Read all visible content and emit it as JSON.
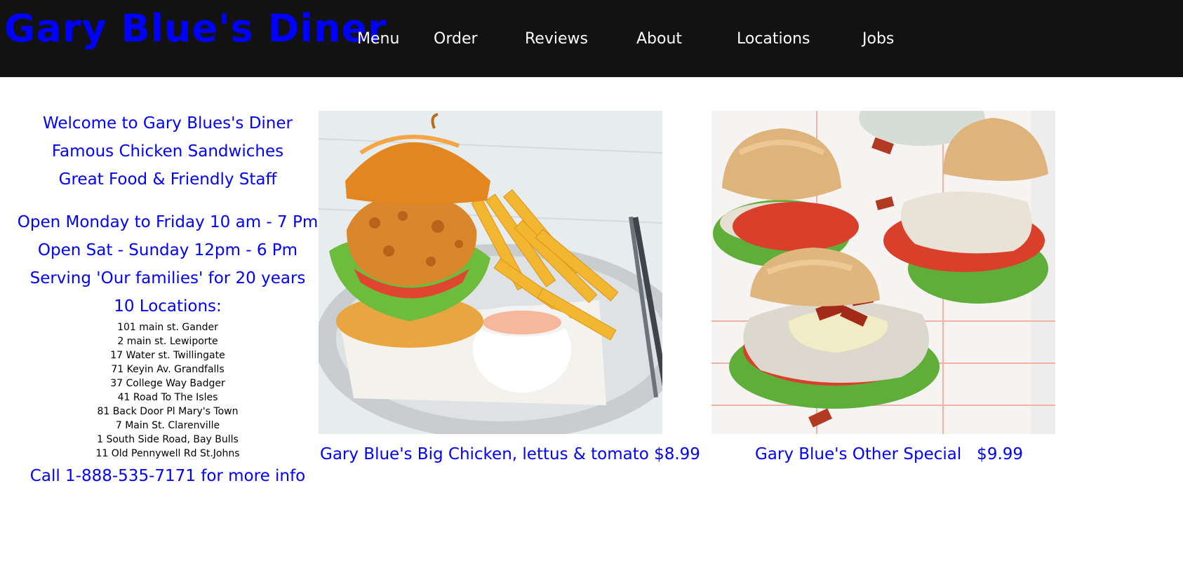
{
  "brand": {
    "name": "Gary Blue's Diner"
  },
  "nav": {
    "items": [
      {
        "label": "Menu"
      },
      {
        "label": "Order"
      },
      {
        "label": "Reviews"
      },
      {
        "label": "About"
      },
      {
        "label": "Locations"
      },
      {
        "label": "Jobs"
      }
    ]
  },
  "info": {
    "welcome": "Welcome to Gary Blues's Diner",
    "tagline1": "Famous Chicken Sandwiches",
    "tagline2": "Great Food & Friendly Staff",
    "hours_week": "Open Monday to Friday 10 am - 7 Pm",
    "hours_weekend": "Open Sat - Sunday 12pm - 6 Pm",
    "serving": "Serving 'Our families' for 20 years",
    "locations_heading": "10 Locations:",
    "addresses": [
      "101 main st. Gander",
      "2 main st. Lewiporte",
      "17 Water st. Twillingate",
      "71 Keyin Av. Grandfalls",
      "37 College Way Badger",
      "41 Road To The Isles",
      "81 Back Door Pl Mary's Town",
      "7 Main St. Clarenville",
      "1 South Side Road, Bay Bulls",
      "11 Old Pennywell Rd St.Johns"
    ],
    "call": "Call 1-888-535-7171 for more info"
  },
  "specials": [
    {
      "caption": "Gary Blue's Big Chicken, lettus & tomato $8.99"
    },
    {
      "caption": "Gary Blue's Other Special   $9.99"
    }
  ],
  "colors": {
    "header_bg": "#121212",
    "brand": "#0000ff",
    "accent_text": "#0000ff"
  }
}
